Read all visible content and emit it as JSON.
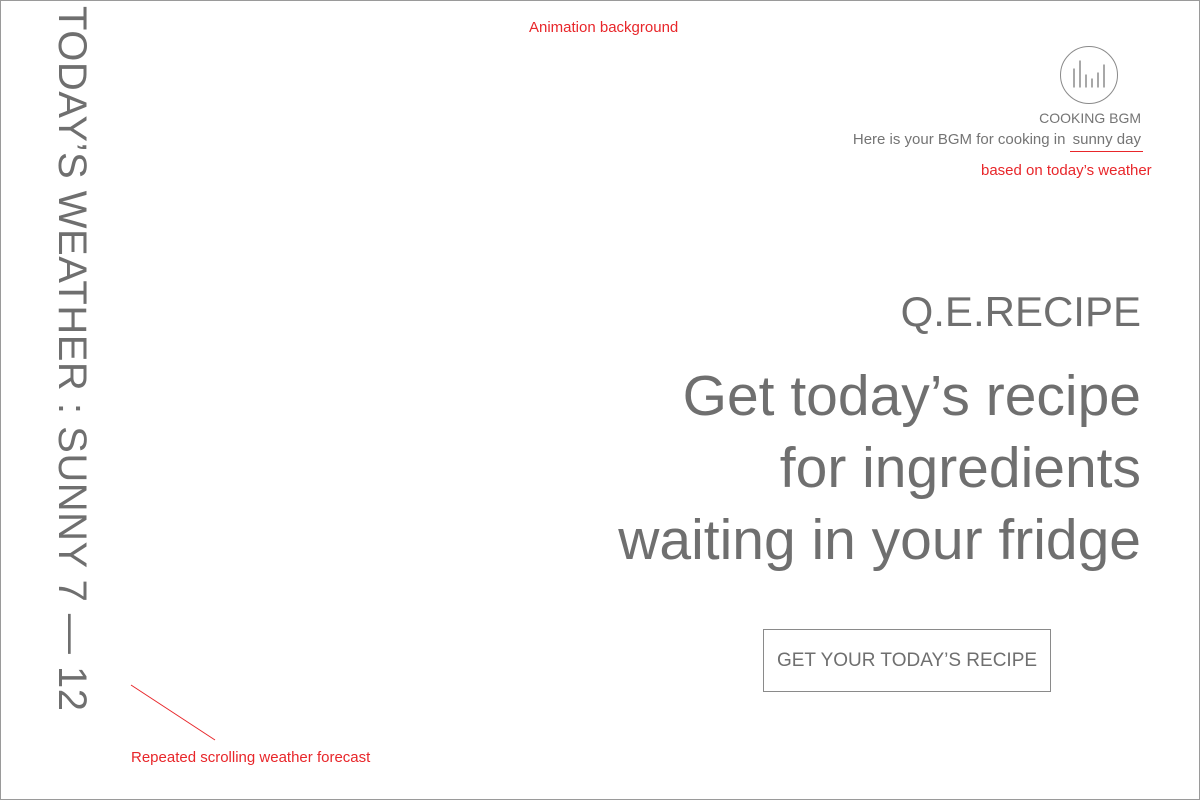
{
  "weather_ticker": {
    "text": "TODAY’S WEATHER : SUNNY 7 — 12"
  },
  "annotations": {
    "animation_background": "Animation background",
    "based_on_weather": "based on today’s weather",
    "scrolling_forecast": "Repeated scrolling weather forecast"
  },
  "bgm": {
    "icon": "audio-equalizer-icon",
    "title": "COOKING BGM",
    "desc_prefix": "Here is your BGM for cooking in",
    "weather_word": "sunny day"
  },
  "hero": {
    "brand": "Q.E.RECIPE",
    "headline_lines": [
      "Get today’s recipe",
      "for ingredients",
      "waiting in your fridge"
    ],
    "cta_label": "GET YOUR TODAY’S RECIPE"
  },
  "colors": {
    "text": "#6f6f6f",
    "annotation": "#e8262a",
    "border": "#8a8a8a",
    "background": "#ffffff"
  }
}
